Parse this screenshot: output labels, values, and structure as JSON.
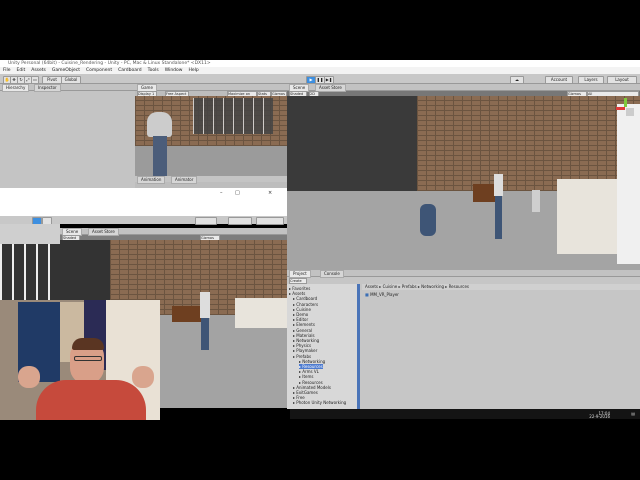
{
  "window": {
    "title": "Unity Personal (64bit) - Cuisine_Rendering - Unity - PC, Mac & Linux Standalone* <DX11>"
  },
  "menu": [
    "File",
    "Edit",
    "Assets",
    "GameObject",
    "Component",
    "Cardboard",
    "Tools",
    "Window",
    "Help"
  ],
  "toolbar": {
    "pivot": "Pivot",
    "global": "Global",
    "account": "Account",
    "layers": "Layers",
    "layout": "Layout"
  },
  "left_tabs": [
    "Hierarchy",
    "Inspector"
  ],
  "game_panel": {
    "tab": "Game",
    "display": "Display 1",
    "aspect": "Free Aspect",
    "maximize": "Maximize on Play",
    "stats": "Stats",
    "gizmos": "Gizmos"
  },
  "scene_panel": {
    "tab": "Scene",
    "asset_store": "Asset Store",
    "shaded": "Shaded",
    "twod": "2D",
    "gizmos": "Gizmos",
    "search": "All"
  },
  "second_window": {
    "scene_tab": "Scene",
    "asset_store": "Asset Store",
    "shaded": "Shaded",
    "gizmos": "Gizmos"
  },
  "small_panels": [
    "Animation",
    "Animator"
  ],
  "project_panel": {
    "tabs": [
      "Project",
      "Console"
    ],
    "create": "Create",
    "breadcrumb": "Assets ▸ Cuisine ▸ Prefabs ▸ Networking ▸ Resources",
    "file": "MM_VR_Player",
    "tree": [
      "Favorites",
      "Assets",
      "Cardboard",
      "Characters",
      "Cuisine",
      "Demo",
      "Editor",
      "Elements",
      "General",
      "Materials",
      "Networking",
      "Physics",
      "Playmaker",
      "Prefabs",
      "Networking",
      "Resources",
      "Arms VL",
      "Items",
      "Resources",
      "Animated Models",
      "ExitGames",
      "Free",
      "Photon Unity Networking"
    ]
  },
  "taskbar": {
    "time": "17:04",
    "date": "22-9-2016"
  }
}
